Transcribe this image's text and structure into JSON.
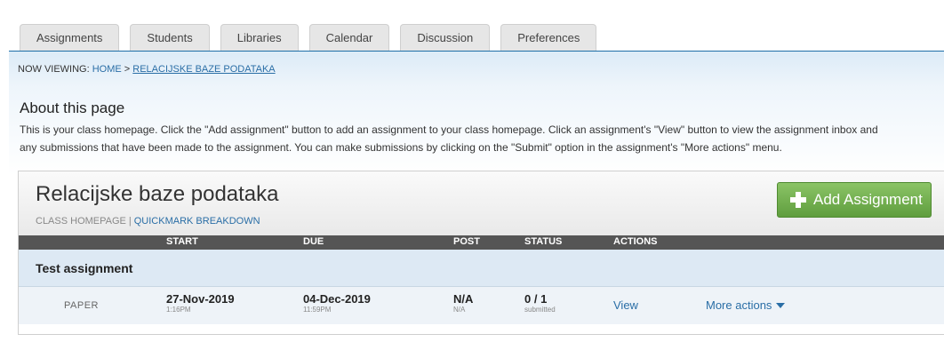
{
  "tabs": [
    {
      "label": "Assignments"
    },
    {
      "label": "Students"
    },
    {
      "label": "Libraries"
    },
    {
      "label": "Calendar"
    },
    {
      "label": "Discussion"
    },
    {
      "label": "Preferences"
    }
  ],
  "breadcrumb": {
    "prefix": "NOW VIEWING: ",
    "home": "HOME",
    "separator": " > ",
    "current": "RELACIJSKE BAZE PODATAKA"
  },
  "about": {
    "title": "About this page",
    "line1": "This is your class homepage. Click the \"Add assignment\" button to add an assignment to your class homepage. Click an assignment's \"View\" button to view the assignment inbox and",
    "line2": "any submissions that have been made to the assignment. You can make submissions by clicking on the \"Submit\" option in the assignment's \"More actions\" menu."
  },
  "class": {
    "title": "Relacijske baze podataka",
    "sub_label": "CLASS HOMEPAGE",
    "sub_sep": "|",
    "quickmark": "QUICKMARK BREAKDOWN",
    "add_button": "Add Assignment"
  },
  "table": {
    "columns": {
      "start": "START",
      "due": "DUE",
      "post": "POST",
      "status": "STATUS",
      "actions": "ACTIONS"
    },
    "group": "Test assignment",
    "row": {
      "type": "PAPER",
      "start_date": "27-Nov-2019",
      "start_time": "1:16PM",
      "due_date": "04-Dec-2019",
      "due_time": "11:59PM",
      "post": "N/A",
      "post_sub": "N/A",
      "status": "0 / 1",
      "status_sub": "submitted",
      "view": "View",
      "more": "More actions"
    }
  },
  "colors": {
    "accent": "#2a6ea6",
    "add_button": "#6fae4b",
    "header_bar": "#555555"
  }
}
